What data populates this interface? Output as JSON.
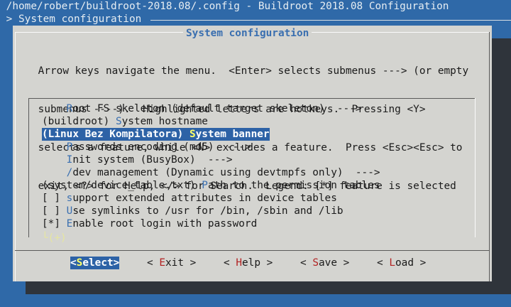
{
  "window": {
    "title": " /home/robert/buildroot-2018.08/.config - Buildroot 2018.08 Configuration",
    "breadcrumb": " > System configuration"
  },
  "dialog": {
    "title": "System configuration",
    "help": [
      " Arrow keys navigate the menu.  <Enter> selects submenus ---> (or empty",
      " submenus ----).  Highlighted letters are hotkeys.  Pressing <Y>",
      " selects a feature, while <N> excludes a feature.  Press <Esc><Esc> to",
      " exit, <?> for Help, </> for Search.  Legend: [*] feature is selected"
    ],
    "items": [
      {
        "pre": "    ",
        "hk": "R",
        "post": "oot FS skeleton (default target skeleton)  --->"
      },
      {
        "pre": "(buildroot) ",
        "hk": "S",
        "post": "ystem hostname"
      },
      {
        "pre": "(Linux Bez Kompilatora) ",
        "hk": "S",
        "post": "ystem banner"
      },
      {
        "pre": "    ",
        "hk": "P",
        "post": "asswords encoding (md5)  --->"
      },
      {
        "pre": "    ",
        "hk": "I",
        "post": "nit system (BusyBox)  --->"
      },
      {
        "pre": "    ",
        "hk": "/",
        "post": "dev management (Dynamic using devtmpfs only)  --->"
      },
      {
        "pre": "(system/device_table.txt) ",
        "hk": "P",
        "post": "ath to the permission tables"
      },
      {
        "pre": "[ ] ",
        "hk": "s",
        "post": "upport extended attributes in device tables"
      },
      {
        "pre": "[ ] ",
        "hk": "U",
        "post": "se symlinks to /usr for /bin, /sbin and /lib"
      },
      {
        "pre": "[*] ",
        "hk": "E",
        "post": "nable root login with password"
      }
    ],
    "selected_index": 2,
    "more_indicator": "└(+)",
    "buttons": [
      {
        "lt": "<",
        "hk": "S",
        "rest": "elect",
        "gt": ">"
      },
      {
        "lt": "< ",
        "hk": "E",
        "rest": "xit",
        "gt": " >"
      },
      {
        "lt": "< ",
        "hk": "H",
        "rest": "elp",
        "gt": " >"
      },
      {
        "lt": "< ",
        "hk": "S",
        "rest": "ave",
        "gt": " >"
      },
      {
        "lt": "< ",
        "hk": "L",
        "rest": "oad",
        "gt": " >"
      }
    ]
  }
}
